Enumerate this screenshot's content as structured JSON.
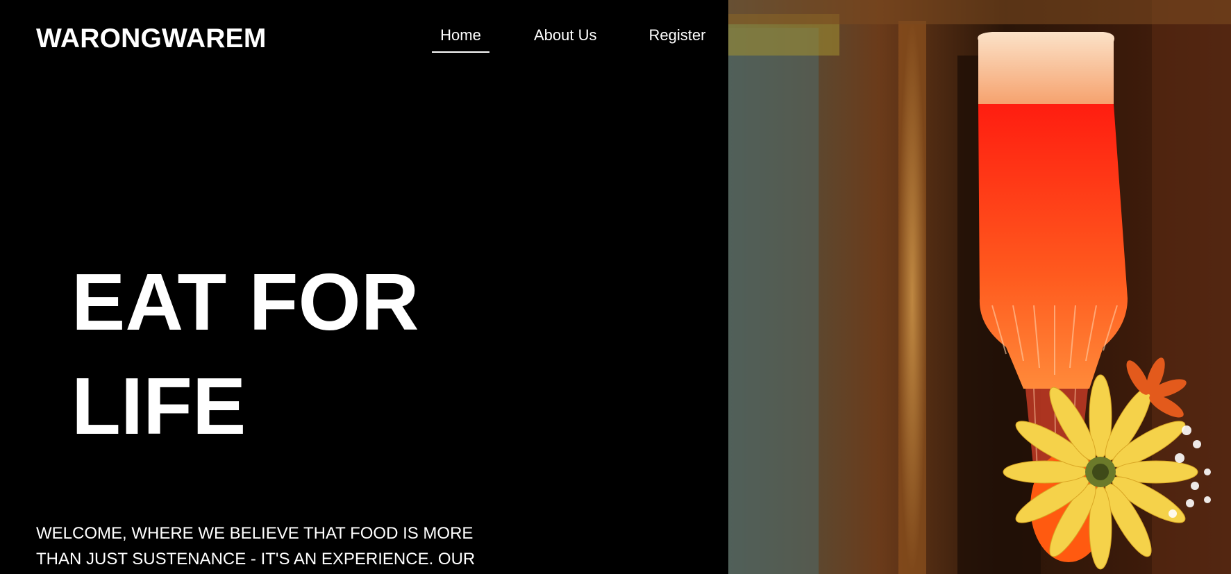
{
  "header": {
    "brand": "WARONGWAREM",
    "nav": [
      {
        "label": "Home",
        "active": true
      },
      {
        "label": "About Us",
        "active": false
      },
      {
        "label": "Register",
        "active": false
      }
    ]
  },
  "hero": {
    "title_line_1": "EAT FOR",
    "title_line_2": "LIFE",
    "welcome_text": "WELCOME, WHERE WE BELIEVE THAT FOOD IS MORE THAN JUST SUSTENANCE - IT'S AN EXPERIENCE. OUR"
  },
  "colors": {
    "background": "#000000",
    "text": "#ffffff",
    "drink": "#ff3a12",
    "flower": "#f5d24a"
  }
}
